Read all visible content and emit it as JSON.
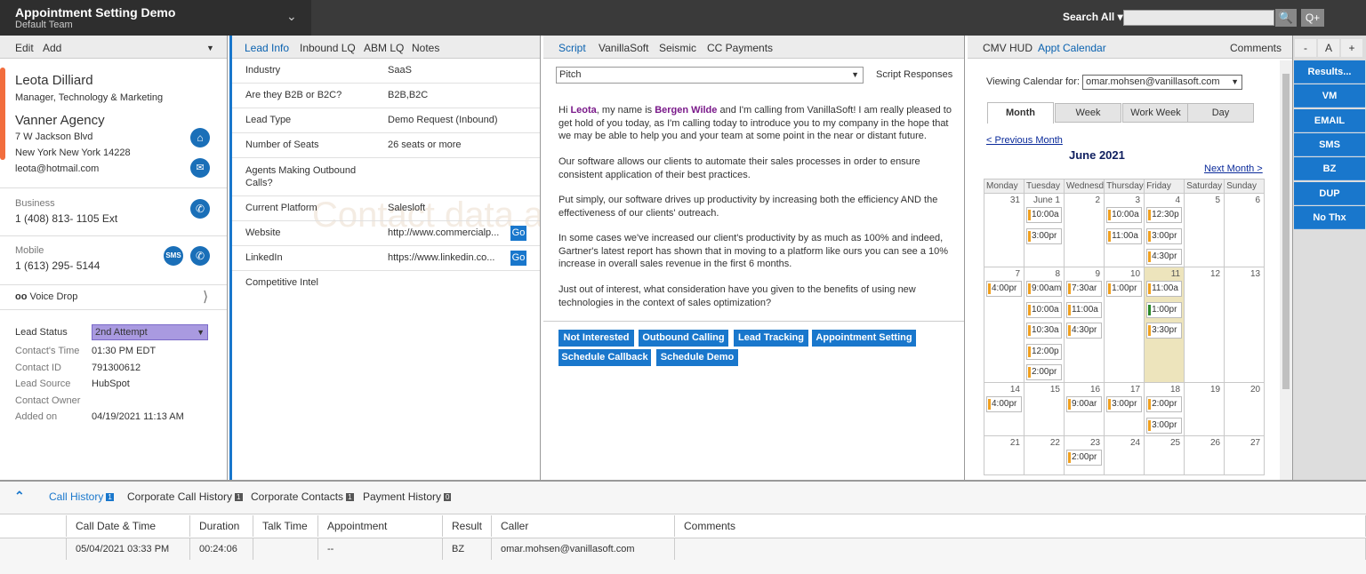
{
  "app": {
    "title": "Appointment Setting Demo",
    "team": "Default Team",
    "search_label": "Search All"
  },
  "contact": {
    "menu": [
      "Edit",
      "Add"
    ],
    "name": "Leota Dilliard",
    "job": "Manager, Technology & Marketing",
    "company": "Vanner Agency",
    "address1": "7 W Jackson Blvd",
    "address2": "New York  New York  14228",
    "email": "leota@hotmail.com",
    "business_label": "Business",
    "business_phone": "1 (408) 813- 1105   Ext",
    "mobile_label": "Mobile",
    "mobile_phone": "1 (613) 295- 5144",
    "sms": "SMS",
    "voice_drop": "Voice Drop",
    "lead_status_label": "Lead Status",
    "lead_status": "2nd Attempt",
    "fields": [
      {
        "k": "Contact's Time",
        "v": "01:30 PM EDT"
      },
      {
        "k": "Contact ID",
        "v": "791300612"
      },
      {
        "k": "Lead Source",
        "v": "HubSpot"
      },
      {
        "k": "Contact Owner",
        "v": ""
      },
      {
        "k": "Added on",
        "v": "04/19/2021 11:13 AM"
      }
    ]
  },
  "lead": {
    "tabs": [
      "Lead Info",
      "Inbound LQ",
      "ABM LQ",
      "Notes"
    ],
    "rows": [
      {
        "k": "Industry",
        "v": "SaaS"
      },
      {
        "k": "Are they B2B or B2C?",
        "v": "B2B,B2C"
      },
      {
        "k": "Lead Type",
        "v": "Demo Request (Inbound)"
      },
      {
        "k": "Number of Seats",
        "v": "26 seats or more"
      },
      {
        "k": "Agents Making Outbound Calls?",
        "v": ""
      },
      {
        "k": "Current Platform",
        "v": "Salesloft"
      },
      {
        "k": "Website",
        "v": "http://www.commercialp..."
      },
      {
        "k": "LinkedIn",
        "v": "https://www.linkedin.co..."
      },
      {
        "k": "Competitive Intel",
        "v": ""
      }
    ],
    "go": "Go",
    "watermark": "Contact data and leads"
  },
  "script": {
    "tabs": [
      "Script",
      "VanillaSoft",
      "Seismic",
      "CC Payments"
    ],
    "select": "Pitch",
    "responses": "Script Responses",
    "p1a": "Hi ",
    "p1name": "Leota",
    "p1b": ", my name is ",
    "p1agent": "Bergen Wilde",
    "p1c": " and I'm calling from VanillaSoft! I am really pleased to get hold of you today, as I'm calling today to introduce you to my company in the hope that we may be able to help you and your team at some point in the near or distant future.",
    "p2": "Our software allows our clients to automate their sales processes in order to ensure consistent application of their best practices.",
    "p3": "Put simply, our software drives up productivity by increasing both the efficiency AND the effectiveness of our clients' outreach.",
    "p4": "In some cases we've increased our client's productivity by as much as 100% and indeed, Gartner's latest report has shown that in moving to a platform like ours you can see a 10% increase in overall sales revenue in the first 6 months.",
    "p5": "Just out of interest, what consideration have you given to the benefits of using new technologies in the context of sales optimization?",
    "buttons": [
      "Not Interested",
      "Outbound Calling",
      "Lead Tracking",
      "Appointment Setting",
      "Schedule Callback",
      "Schedule Demo"
    ]
  },
  "calendar": {
    "tabs": [
      "CMV HUD",
      "Appt Calendar"
    ],
    "comments": "Comments",
    "zoom": [
      "-",
      "A",
      "+"
    ],
    "viewing_label": "Viewing Calendar for:",
    "user": "omar.mohsen@vanillasoft.com",
    "views": [
      "Month",
      "Week",
      "Work Week",
      "Day"
    ],
    "prev": "< Previous Month",
    "month": "June 2021",
    "next": "Next Month >",
    "days": [
      "Monday",
      "Tuesday",
      "Wednesd",
      "Thursday",
      "Friday",
      "Saturday",
      "Sunday"
    ],
    "weeks": [
      [
        {
          "d": "31",
          "e": []
        },
        {
          "d": "June 1",
          "e": [
            "10:00a",
            "3:00pr"
          ]
        },
        {
          "d": "2",
          "e": []
        },
        {
          "d": "3",
          "e": [
            "10:00a",
            "11:00a"
          ]
        },
        {
          "d": "4",
          "e": [
            "12:30p",
            "3:00pr",
            "4:30pr"
          ]
        },
        {
          "d": "5",
          "e": []
        },
        {
          "d": "6",
          "e": []
        }
      ],
      [
        {
          "d": "7",
          "e": [
            "4:00pr"
          ]
        },
        {
          "d": "8",
          "e": [
            "9:00am",
            "10:00a",
            "10:30a",
            "12:00p",
            "2:00pr"
          ]
        },
        {
          "d": "9",
          "e": [
            "7:30ar",
            "11:00a",
            "4:30pr"
          ]
        },
        {
          "d": "10",
          "e": [
            "1:00pr"
          ]
        },
        {
          "d": "11",
          "e": [
            "11:00a",
            "1:00pr",
            "3:30pr"
          ]
        },
        {
          "d": "12",
          "e": []
        },
        {
          "d": "13",
          "e": []
        }
      ],
      [
        {
          "d": "14",
          "e": [
            "4:00pr"
          ]
        },
        {
          "d": "15",
          "e": []
        },
        {
          "d": "16",
          "e": [
            "9:00ar"
          ]
        },
        {
          "d": "17",
          "e": [
            "3:00pr"
          ]
        },
        {
          "d": "18",
          "e": [
            "2:00pr",
            "3:00pr"
          ]
        },
        {
          "d": "19",
          "e": []
        },
        {
          "d": "20",
          "e": []
        }
      ],
      [
        {
          "d": "21",
          "e": []
        },
        {
          "d": "22",
          "e": []
        },
        {
          "d": "23",
          "e": [
            "2:00pr"
          ]
        },
        {
          "d": "24",
          "e": []
        },
        {
          "d": "25",
          "e": []
        },
        {
          "d": "26",
          "e": []
        },
        {
          "d": "27",
          "e": []
        }
      ]
    ]
  },
  "actions": [
    "Results...",
    "VM",
    "EMAIL",
    "SMS",
    "BZ",
    "DUP",
    "No Thx"
  ],
  "bottom": {
    "tabs": [
      {
        "label": "Call History",
        "n": "1"
      },
      {
        "label": "Corporate Call History",
        "n": "1"
      },
      {
        "label": "Corporate Contacts",
        "n": "1"
      },
      {
        "label": "Payment History",
        "n": "0"
      }
    ],
    "headers": [
      "Call Date & Time",
      "Duration",
      "Talk Time",
      "Appointment",
      "Result",
      "Caller",
      "Comments"
    ],
    "row": [
      "05/04/2021 03:33 PM",
      "00:24:06",
      "",
      "--",
      "BZ",
      "omar.mohsen@vanillasoft.com",
      ""
    ]
  },
  "colors": {
    "accent": "#1977cc",
    "orange": "#f26d3d",
    "status_bg": "#a99ae0",
    "today": "#ede4bc"
  }
}
